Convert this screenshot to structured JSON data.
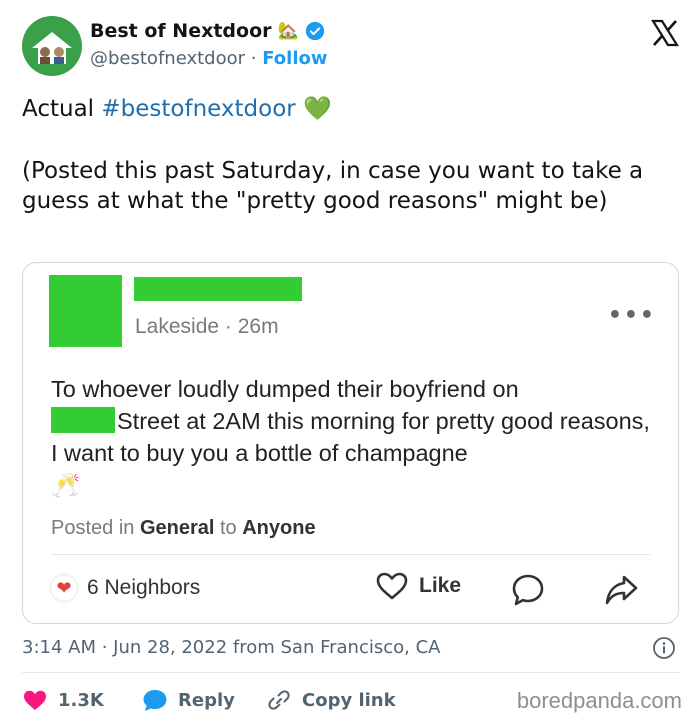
{
  "author": {
    "name": "Best of Nextdoor",
    "name_emoji": "🏡",
    "handle": "@bestofnextdoor",
    "separator": "·",
    "follow_label": "Follow"
  },
  "tweet": {
    "text_prefix": "Actual ",
    "hashtag": "#bestofnextdoor",
    "heart": "💚",
    "paragraph2": "(Posted this past Saturday, in case you want to take a guess at what the \"pretty good reasons\" might be)"
  },
  "embedded_post": {
    "location": "Lakeside",
    "dot": "·",
    "age": "26m",
    "more": "•••",
    "body_line1": "To whoever loudly dumped their boyfriend on",
    "body_after_redaction": "Street at 2AM this morning for pretty good reasons, I want to buy you a bottle of champagne",
    "body_emoji": "🥂",
    "posted_in_prefix": "Posted in ",
    "category": "General",
    "posted_to": " to ",
    "audience": "Anyone",
    "reactions_label": "6 Neighbors",
    "like_label": "Like"
  },
  "tweet_meta": {
    "timestamp": "3:14 AM · Jun 28, 2022 from San Francisco, CA"
  },
  "actions": {
    "likes_count": "1.3K",
    "reply_label": "Reply",
    "copy_link_label": "Copy link"
  },
  "watermark": "boredpanda.com",
  "colors": {
    "link_blue": "#1d9bf0",
    "redaction_green": "#33cc33",
    "like_pink": "#f91880"
  }
}
